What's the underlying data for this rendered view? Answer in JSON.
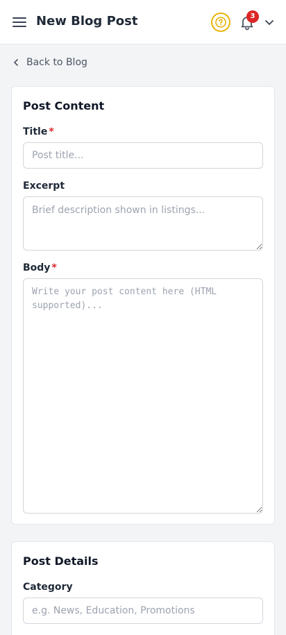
{
  "header": {
    "title": "New Blog Post",
    "notification_count": "3",
    "accent_help": "#eab308",
    "badge_color": "#dc2626"
  },
  "nav": {
    "back_label": "Back to Blog"
  },
  "post_content": {
    "heading": "Post Content",
    "title_label": "Title",
    "title_required": "*",
    "title_placeholder": "Post title...",
    "excerpt_label": "Excerpt",
    "excerpt_placeholder": "Brief description shown in listings...",
    "body_label": "Body",
    "body_required": "*",
    "body_placeholder": "Write your post content here (HTML supported)..."
  },
  "post_details": {
    "heading": "Post Details",
    "category_label": "Category",
    "category_placeholder": "e.g. News, Education, Promotions"
  },
  "icons": {
    "menu": "hamburger-menu-icon",
    "help": "question-circle-icon",
    "notifications": "bell-icon",
    "account": "chevron-down-icon",
    "back": "chevron-left-icon"
  }
}
